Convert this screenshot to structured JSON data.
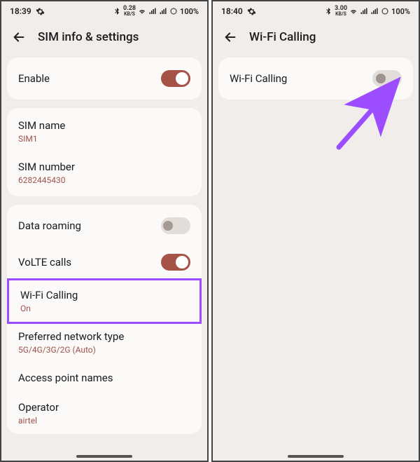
{
  "left_phone": {
    "statusbar": {
      "time": "18:39",
      "net_rate": "0.28",
      "net_unit": "KB/S",
      "battery": "100%"
    },
    "header": {
      "title": "SIM info & settings"
    },
    "enable": {
      "label": "Enable",
      "on": true
    },
    "sim_name": {
      "label": "SIM name",
      "value": "SIM1"
    },
    "sim_number": {
      "label": "SIM number",
      "value": "6282445430"
    },
    "data_roaming": {
      "label": "Data roaming",
      "on": false
    },
    "volte": {
      "label": "VoLTE calls",
      "on": true
    },
    "wifi_calling": {
      "label": "Wi-Fi Calling",
      "value": "On"
    },
    "preferred_network": {
      "label": "Preferred network type",
      "value": "5G/4G/3G/2G (Auto)"
    },
    "apn": {
      "label": "Access point names"
    },
    "operator": {
      "label": "Operator",
      "value": "airtel"
    }
  },
  "right_phone": {
    "statusbar": {
      "time": "18:40",
      "net_rate": "3.00",
      "net_unit": "KB/S",
      "battery": "100%"
    },
    "header": {
      "title": "Wi-Fi Calling"
    },
    "wifi_calling": {
      "label": "Wi-Fi Calling",
      "on": false
    }
  }
}
